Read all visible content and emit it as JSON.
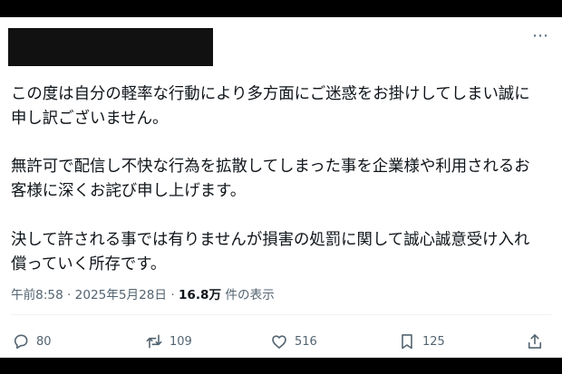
{
  "post": {
    "paragraphs": [
      "この度は自分の軽率な行動により多方面にご迷惑をお掛けしてしまい誠に\n申し訳ございません。",
      "無許可で配信し不快な行為を拡散してしまった事を企業様や利用されるお\n客様に深くお詫び申し上げます。",
      "決して許される事では有りませんが損害の処罰に関して誠心誠意受け入れ\n償っていく所存です。"
    ],
    "timestamp": "午前8:58 · 2025年5月28日 · ",
    "views": "16.8万",
    "views_label": " 件の表示",
    "more_icon": "⋯"
  },
  "actions": {
    "replies": "80",
    "reposts": "109",
    "likes": "516",
    "bookmarks": "125"
  },
  "icons": {
    "reply": "reply-icon",
    "repost": "repost-icon",
    "like": "like-icon",
    "bookmark": "bookmark-icon",
    "share": "share-icon",
    "more": "more-icon"
  },
  "colors": {
    "text": "#0f1419",
    "secondary": "#536471",
    "letterbox": "#000000"
  }
}
